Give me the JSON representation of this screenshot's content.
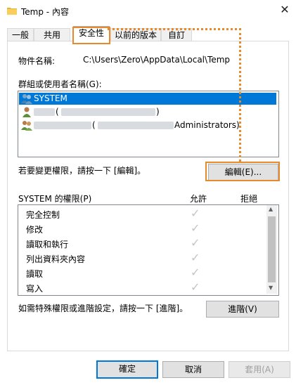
{
  "window": {
    "title": "Temp - 內容",
    "close_glyph": "✕"
  },
  "tabs": [
    {
      "label": "一般"
    },
    {
      "label": "共用"
    },
    {
      "label": "安全性"
    },
    {
      "label": "以前的版本"
    },
    {
      "label": "自訂"
    }
  ],
  "security": {
    "object_label": "物件名稱:",
    "object_path": "C:\\Users\\Zero\\AppData\\Local\\Temp",
    "groups_label": "群組或使用者名稱(G):",
    "principals": [
      {
        "name": "SYSTEM",
        "selected": true,
        "icon": "users-group-icon"
      },
      {
        "name": "(",
        "suffix": ")",
        "selected": false,
        "icon": "user-icon"
      },
      {
        "name": "(",
        "suffix": "Administrators)",
        "selected": false,
        "icon": "users-group-icon"
      }
    ],
    "change_hint": "若要變更權限，請按一下 [編輯]。",
    "edit_button": "編輯(E)...",
    "permissions_label": "SYSTEM 的權限(P)",
    "allow_header": "允許",
    "deny_header": "拒絕",
    "permissions": [
      {
        "name": "完全控制",
        "allow": true,
        "deny": false
      },
      {
        "name": "修改",
        "allow": true,
        "deny": false
      },
      {
        "name": "讀取和執行",
        "allow": true,
        "deny": false
      },
      {
        "name": "列出資料夾內容",
        "allow": true,
        "deny": false
      },
      {
        "name": "讀取",
        "allow": true,
        "deny": false
      },
      {
        "name": "寫入",
        "allow": true,
        "deny": false
      }
    ],
    "check_glyph": "✓",
    "advanced_hint": "如需特殊權限或進階設定，請按一下 [進階]。",
    "advanced_button": "進階(V)"
  },
  "footer": {
    "ok": "確定",
    "cancel": "取消",
    "apply": "套用(A)"
  },
  "scroll_glyphs": {
    "up": "▲",
    "down": "▼"
  },
  "colors": {
    "accent": "#0078d7",
    "highlight": "#e8892b"
  }
}
